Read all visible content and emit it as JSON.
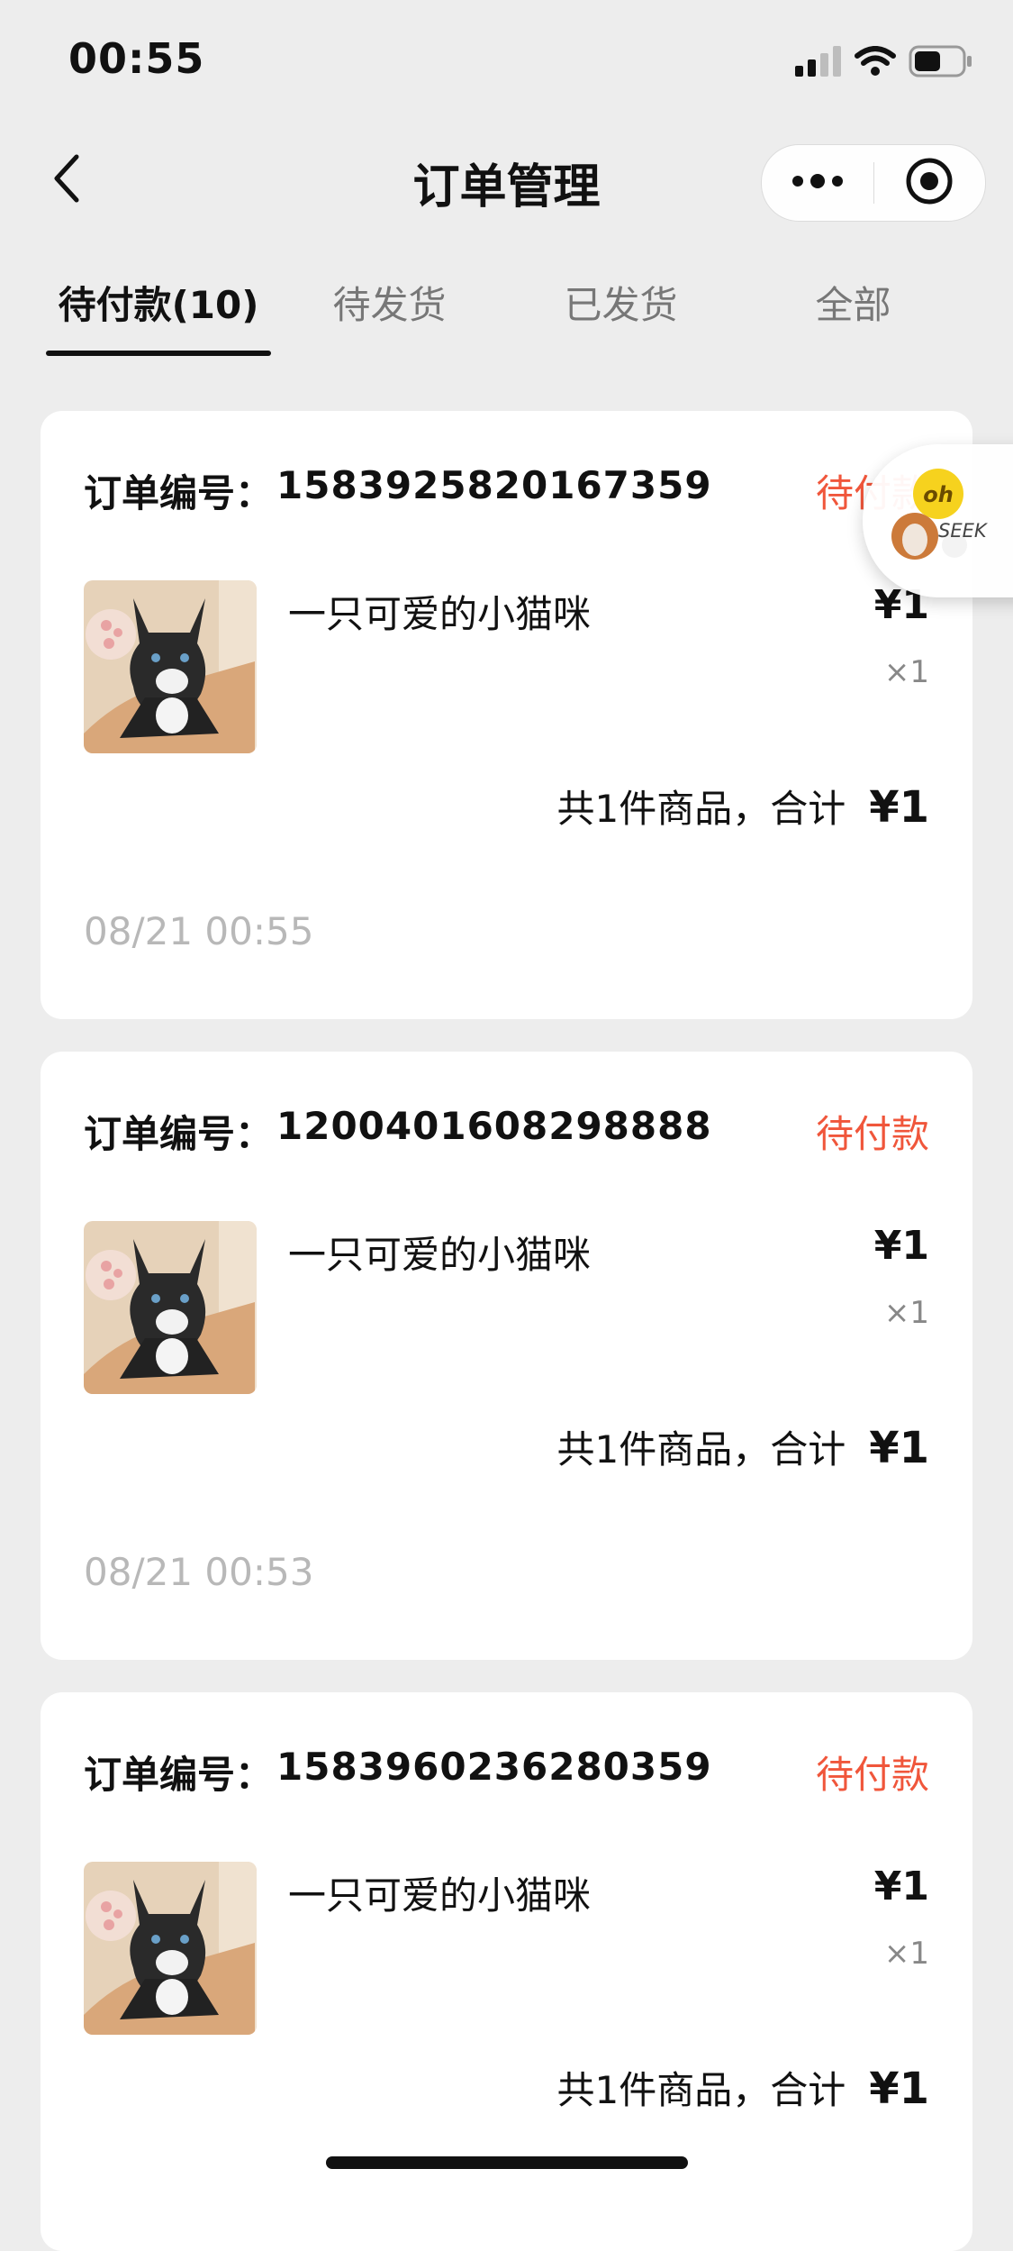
{
  "status_bar": {
    "time": "00:55",
    "icons": [
      "signal-icon",
      "wifi-icon",
      "battery-icon"
    ]
  },
  "navbar": {
    "title": "订单管理",
    "back_icon": "chevron-left-icon",
    "more_icon": "more-icon",
    "close_icon": "record-icon"
  },
  "tabs": [
    {
      "label": "待付款(10)",
      "active": true
    },
    {
      "label": "待发货",
      "active": false
    },
    {
      "label": "已发货",
      "active": false
    },
    {
      "label": "全部",
      "active": false
    }
  ],
  "orders": [
    {
      "order_no_label": "订单编号：",
      "order_no": "1583925820167359",
      "status": "待付款",
      "item_name": "一只可爱的小猫咪",
      "price": "¥1",
      "qty": "×1",
      "summary_text": "共1件商品，合计",
      "total": "¥1",
      "time": "08/21 00:55"
    },
    {
      "order_no_label": "订单编号：",
      "order_no": "1200401608298888",
      "status": "待付款",
      "item_name": "一只可爱的小猫咪",
      "price": "¥1",
      "qty": "×1",
      "summary_text": "共1件商品，合计",
      "total": "¥1",
      "time": "08/21 00:53"
    },
    {
      "order_no_label": "订单编号：",
      "order_no": "1583960236280359",
      "status": "待付款",
      "item_name": "一只可爱的小猫咪",
      "price": "¥1",
      "qty": "×1",
      "summary_text": "共1件商品，合计",
      "total": "¥1",
      "time": ""
    }
  ],
  "floating_widget": {
    "label": "SEEK"
  },
  "colors": {
    "background": "#ededed",
    "card": "#ffffff",
    "accent": "#f0563b",
    "muted": "#b8b8b8"
  }
}
